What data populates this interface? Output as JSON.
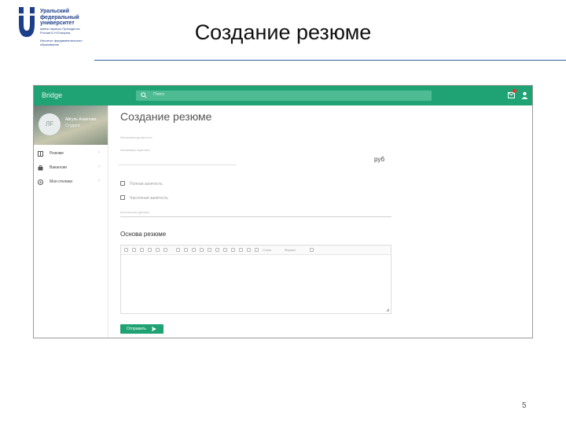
{
  "slide": {
    "university_line1": "Уральский",
    "university_line2": "федеральный",
    "university_line3": "университет",
    "university_sub1": "имени первого Президента России Б.Н.Ельцина",
    "university_sub2": "Институт фундаментального образования",
    "title": "Создание резюме",
    "page_number": "5"
  },
  "app": {
    "brand": "Bridge",
    "search_placeholder": "Поиск",
    "profile": {
      "avatar_initials": "ЛF",
      "name": "Айгуль Ахметова",
      "role": "Студент"
    },
    "nav": [
      {
        "label": "Резюме",
        "icon": "book-icon"
      },
      {
        "label": "Вакансии",
        "icon": "briefcase-icon"
      },
      {
        "label": "Мои отклики",
        "icon": "info-icon"
      }
    ],
    "form": {
      "heading": "Создание резюме",
      "position_hint": "Желаемая должность",
      "salary_hint": "Желаемая зарплата",
      "currency": "руб",
      "checkbox_full_time": "Полная занятость",
      "checkbox_part_time": "Частичная занятость",
      "contacts_hint": "Контактные данные",
      "section_title": "Основа резюме",
      "toolbar_dropdown_style": "Стиль",
      "toolbar_dropdown_format": "Формат",
      "submit_label": "Отправить"
    }
  }
}
